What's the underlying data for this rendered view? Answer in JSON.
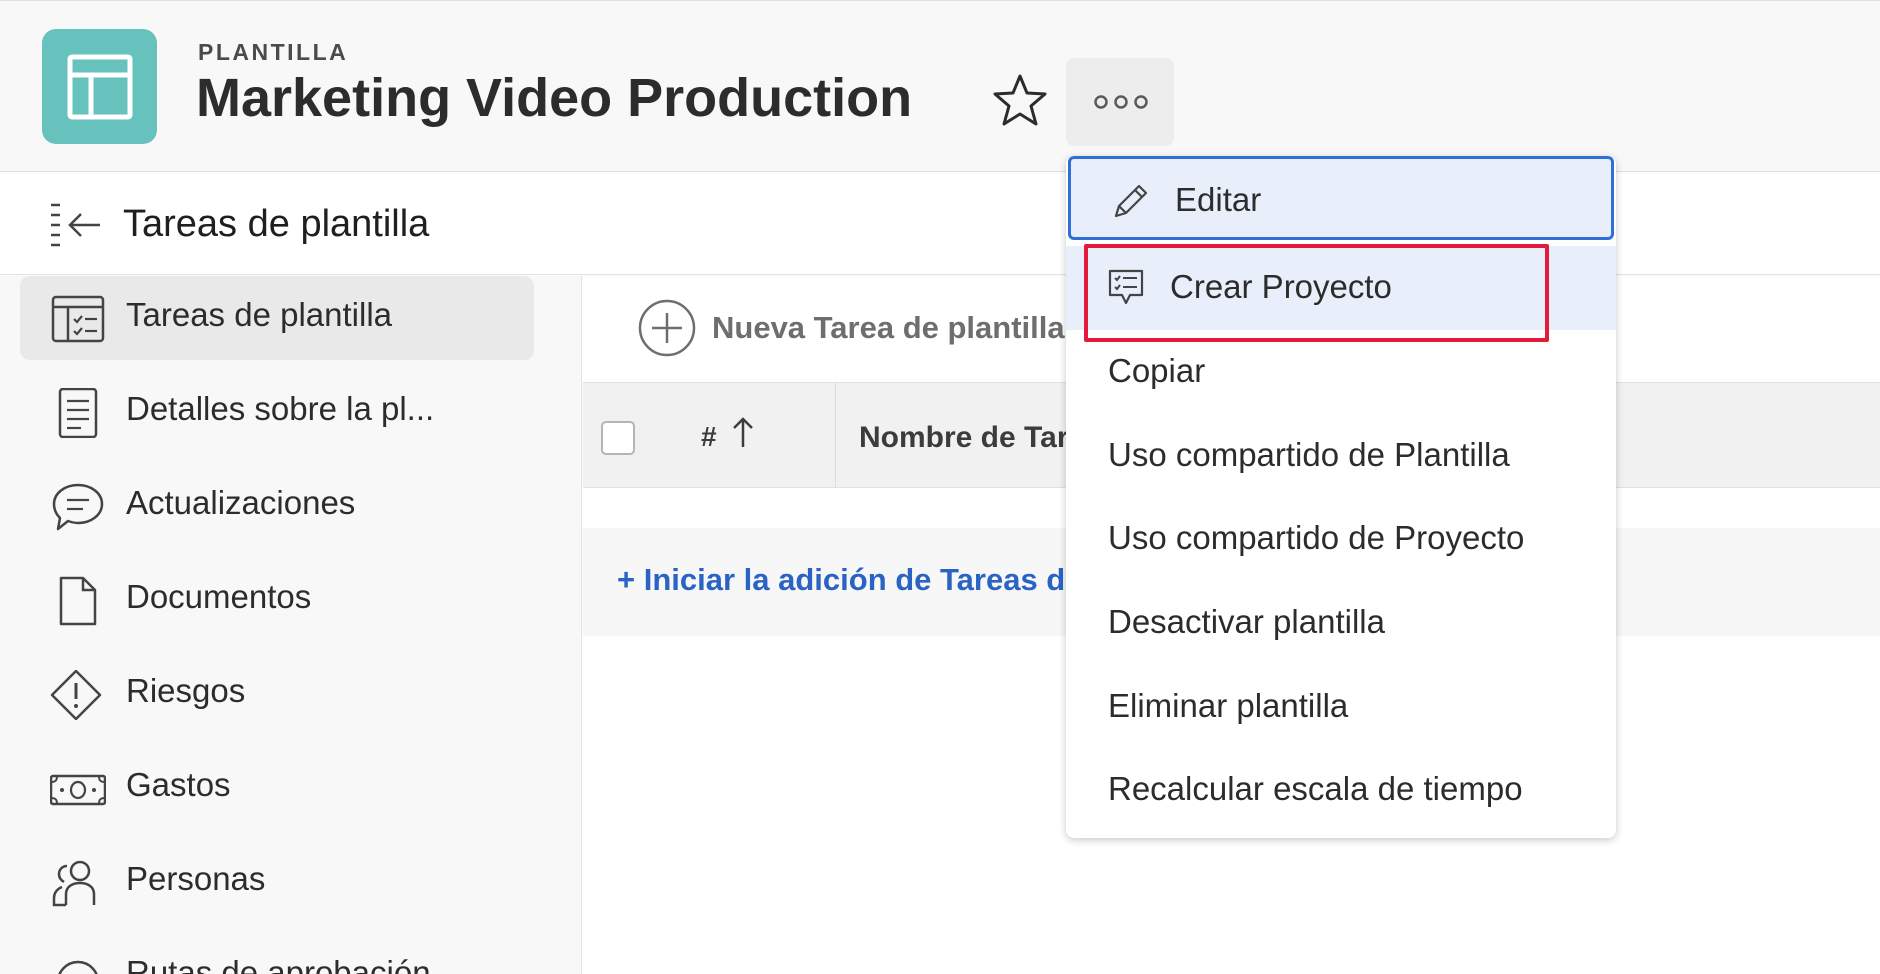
{
  "header": {
    "eyebrow": "PLANTILLA",
    "title": "Marketing Video Production",
    "app_icon": "layout-template-icon",
    "favorite_icon": "star-icon",
    "more_icon": "more-horizontal-icon"
  },
  "subheader": {
    "collapse_icon": "collapse-panel-icon",
    "title": "Tareas de plantilla"
  },
  "sidebar": {
    "items": [
      {
        "label": "Tareas de plantilla",
        "icon": "task-list-icon",
        "active": true
      },
      {
        "label": "Detalles sobre la pl...",
        "icon": "document-lines-icon"
      },
      {
        "label": "Actualizaciones",
        "icon": "chat-bubble-icon"
      },
      {
        "label": "Documentos",
        "icon": "file-icon"
      },
      {
        "label": "Riesgos",
        "icon": "risk-diamond-icon"
      },
      {
        "label": "Gastos",
        "icon": "money-icon"
      },
      {
        "label": "Personas",
        "icon": "people-icon"
      },
      {
        "label": "Rutas de aprobación",
        "icon": "approval-icon"
      }
    ]
  },
  "main": {
    "new_task_label": "Nueva Tarea de plantilla",
    "table": {
      "col_number": "#",
      "col_name": "Nombre de Tarea"
    },
    "start_link": "+ Iniciar la adición de Tareas de plantilla"
  },
  "menu": {
    "items": [
      {
        "label": "Editar",
        "icon": "pencil-icon"
      },
      {
        "label": "Crear Proyecto",
        "icon": "create-project-icon"
      },
      {
        "label": "Copiar"
      },
      {
        "label": "Uso compartido de Plantilla"
      },
      {
        "label": "Uso compartido de Proyecto"
      },
      {
        "label": "Desactivar plantilla"
      },
      {
        "label": "Eliminar plantilla"
      },
      {
        "label": "Recalcular escala de tiempo"
      }
    ]
  },
  "colors": {
    "app_tile": "#67c1bd",
    "link_blue": "#2b63c4",
    "focus_blue": "#2f6fd6",
    "annotation_red": "#e21b3c"
  }
}
